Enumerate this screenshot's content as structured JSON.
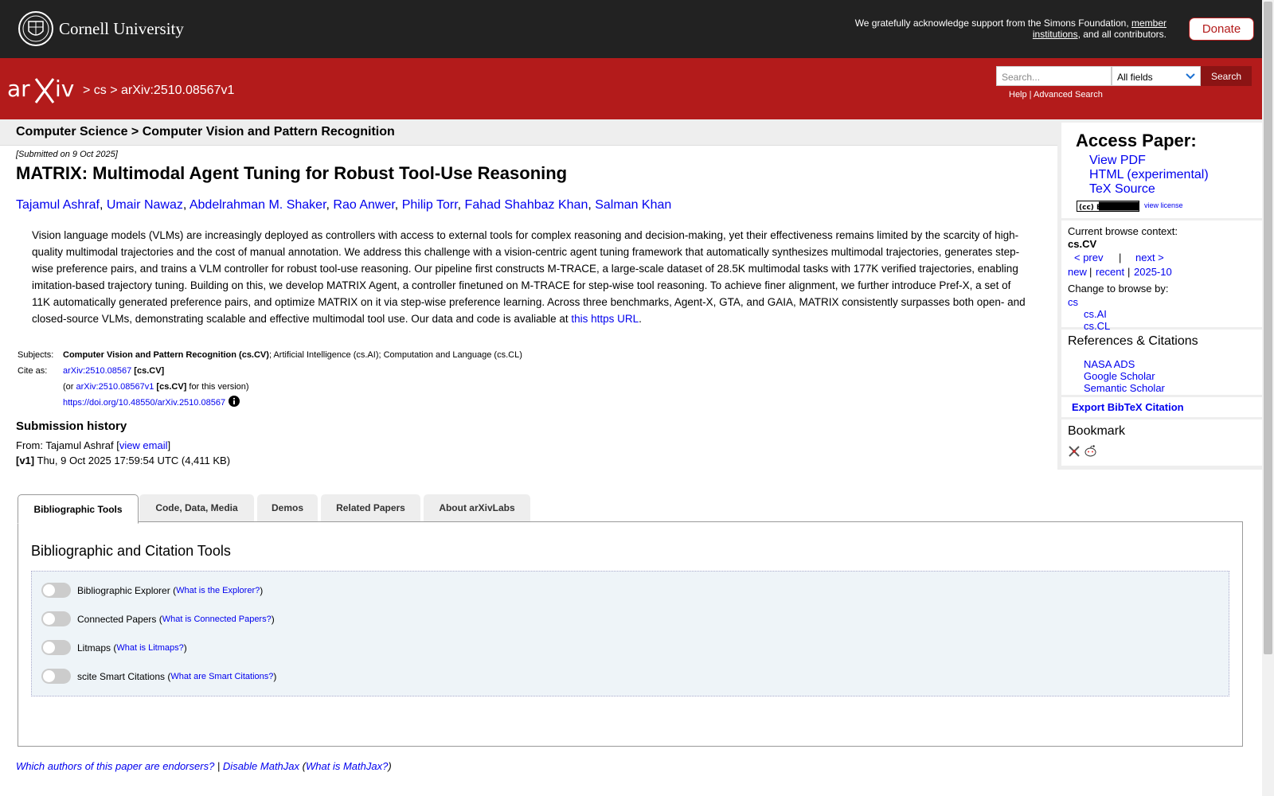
{
  "top": {
    "university": "Cornell University",
    "support_text": "We gratefully acknowledge support from the Simons Foundation, ",
    "support_link": "member institutions",
    "support_tail": ", and all contributors.",
    "donate": "Donate"
  },
  "header": {
    "breadcrumb": "> cs > arXiv:2510.08567v1",
    "search_placeholder": "Search...",
    "search_field": "All fields",
    "search_button": "Search",
    "help": "Help",
    "help_sep": " | ",
    "advanced": "Advanced Search"
  },
  "subject_strip": "Computer Science > Computer Vision and Pattern Recognition",
  "paper": {
    "submitted": "[Submitted on 9 Oct 2025]",
    "title": "MATRIX: Multimodal Agent Tuning for Robust Tool-Use Reasoning",
    "authors": [
      "Tajamul Ashraf",
      "Umair Nawaz",
      "Abdelrahman M. Shaker",
      "Rao Anwer",
      "Philip Torr",
      "Fahad Shahbaz Khan",
      "Salman Khan"
    ],
    "author_sep": ", ",
    "abstract": "Vision language models (VLMs) are increasingly deployed as controllers with access to external tools for complex reasoning and decision-making, yet their effectiveness remains limited by the scarcity of high-quality multimodal trajectories and the cost of manual annotation. We address this challenge with a vision-centric agent tuning framework that automatically synthesizes multimodal trajectories, generates step-wise preference pairs, and trains a VLM controller for robust tool-use reasoning. Our pipeline first constructs M-TRACE, a large-scale dataset of 28.5K multimodal tasks with 177K verified trajectories, enabling imitation-based trajectory tuning. Building on this, we develop MATRIX Agent, a controller finetuned on M-TRACE for step-wise tool reasoning. To achieve finer alignment, we further introduce Pref-X, a set of 11K automatically generated preference pairs, and optimize MATRIX on it via step-wise preference learning. Across three benchmarks, Agent-X, GTA, and GAIA, MATRIX consistently surpasses both open- and closed-source VLMs, demonstrating scalable and effective multimodal tool use. Our data and code is avaliable at ",
    "abstract_link": "this https URL",
    "abstract_end": "."
  },
  "meta": {
    "subjects_label": "Subjects:",
    "subjects_primary": "Computer Vision and Pattern Recognition (cs.CV)",
    "subjects_rest": "; Artificial Intelligence (cs.AI); Computation and Language (cs.CL)",
    "cite_label": "Cite as:",
    "cite_id": "arXiv:2510.08567",
    "cite_cat": " [cs.CV]",
    "cite_or": "(or ",
    "cite_version": "arXiv:2510.08567v1",
    "cite_version_cat": " [cs.CV]",
    "cite_version_tail": " for this version)",
    "doi": "https://doi.org/10.48550/arXiv.2510.08567"
  },
  "history": {
    "title": "Submission history",
    "from": "From: Tajamul Ashraf [",
    "view_email": "view email",
    "from_end": "]",
    "v1_label": "[v1]",
    "v1_text": " Thu, 9 Oct 2025 17:59:54 UTC (4,411 KB)"
  },
  "sidebar": {
    "access_title": "Access Paper:",
    "view_pdf": "View PDF",
    "html": "HTML (experimental)",
    "tex": "TeX Source",
    "cc_badge": "(cc) BY",
    "view_license": "view license",
    "context_label": "Current browse context:",
    "context": "cs.CV",
    "prev": "< prev",
    "pipe": "|",
    "next": "next >",
    "new": "new",
    "recent": "recent",
    "month": "2025-10",
    "change_label": "Change to browse by:",
    "cs": "cs",
    "cs_ai": "cs.AI",
    "cs_cl": "cs.CL",
    "refs_title": "References & Citations",
    "nasa": "NASA ADS",
    "google": "Google Scholar",
    "semantic": "Semantic Scholar",
    "bibtex": "Export BibTeX Citation",
    "bookmark": "Bookmark"
  },
  "tabs": [
    "Bibliographic Tools",
    "Code, Data, Media",
    "Demos",
    "Related Papers",
    "About arXivLabs"
  ],
  "tools": {
    "panel_title": "Bibliographic and Citation Tools",
    "rows": [
      {
        "name": "Bibliographic Explorer",
        "help": "What is the Explorer?"
      },
      {
        "name": "Connected Papers",
        "help": "What is Connected Papers?"
      },
      {
        "name": "Litmaps",
        "help": "What is Litmaps?"
      },
      {
        "name": "scite Smart Citations",
        "help": "What are Smart Citations?"
      }
    ]
  },
  "footer": {
    "endorsers": "Which authors of this paper are endorsers?",
    "sep": " | ",
    "disable": "Disable MathJax",
    "what": "What is MathJax?"
  },
  "colors": {
    "arxiv_red": "#b31b1b",
    "top_black": "#222222",
    "link": "#0000ee"
  }
}
